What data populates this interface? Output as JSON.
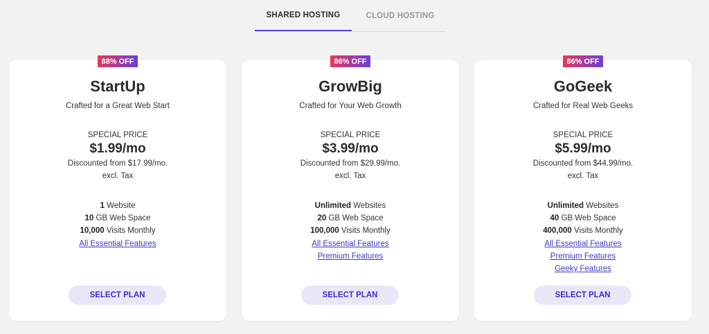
{
  "tabs": [
    {
      "label": "SHARED HOSTING",
      "active": true
    },
    {
      "label": "CLOUD HOSTING",
      "active": false
    }
  ],
  "colors": {
    "accent": "#5a47e0",
    "badge_start": "#e8385a",
    "badge_end": "#6a3fd8",
    "button_bg": "#e9e6f8",
    "button_text": "#3a2fc9",
    "link": "#3b3bc4"
  },
  "plans": [
    {
      "badge": "88% OFF",
      "name": "StartUp",
      "tagline": "Crafted for a Great Web Start",
      "special_label": "SPECIAL PRICE",
      "price": "$1.99/mo",
      "discount": "Discounted from $17.99/mo.",
      "tax": "excl. Tax",
      "features": [
        {
          "bold": "1",
          "text": " Website"
        },
        {
          "bold": "10",
          "text": " GB Web Space"
        },
        {
          "bold": "10,000",
          "text": " Visits Monthly"
        }
      ],
      "links": [
        "All Essential Features"
      ],
      "button": "SELECT PLAN"
    },
    {
      "badge": "86% OFF",
      "name": "GrowBig",
      "tagline": "Crafted for Your Web Growth",
      "special_label": "SPECIAL PRICE",
      "price": "$3.99/mo",
      "discount": "Discounted from $29.99/mo.",
      "tax": "excl. Tax",
      "features": [
        {
          "bold": "Unlimited",
          "text": " Websites"
        },
        {
          "bold": "20",
          "text": " GB Web Space"
        },
        {
          "bold": "100,000",
          "text": " Visits Monthly"
        }
      ],
      "links": [
        "All Essential Features",
        "Premium Features"
      ],
      "button": "SELECT PLAN"
    },
    {
      "badge": "86% OFF",
      "name": "GoGeek",
      "tagline": "Crafted for Real Web Geeks",
      "special_label": "SPECIAL PRICE",
      "price": "$5.99/mo",
      "discount": "Discounted from $44.99/mo.",
      "tax": "excl. Tax",
      "features": [
        {
          "bold": "Unlimited",
          "text": " Websites"
        },
        {
          "bold": "40",
          "text": " GB Web Space"
        },
        {
          "bold": "400,000",
          "text": " Visits Monthly"
        }
      ],
      "links": [
        "All Essential Features",
        "Premium Features",
        "Geeky Features"
      ],
      "button": "SELECT PLAN"
    }
  ]
}
